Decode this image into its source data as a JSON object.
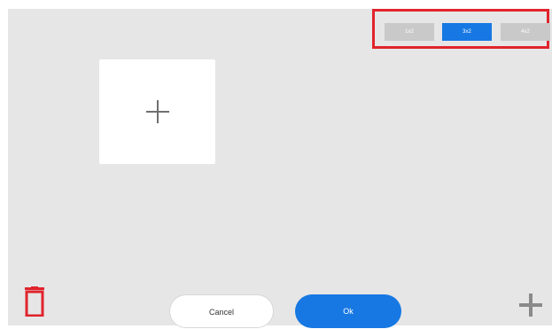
{
  "layout_selector": {
    "options": [
      {
        "label": "1x2",
        "active": false
      },
      {
        "label": "3x2",
        "active": true
      },
      {
        "label": "4x2",
        "active": false
      }
    ],
    "highlight_color": "#e0242c",
    "active_color": "#1778e3",
    "inactive_color": "#c9c9c9"
  },
  "slot": {
    "icon": "plus-icon"
  },
  "footer": {
    "delete_icon": "trash-icon",
    "cancel_label": "Cancel",
    "ok_label": "Ok",
    "add_icon": "plus-icon"
  }
}
